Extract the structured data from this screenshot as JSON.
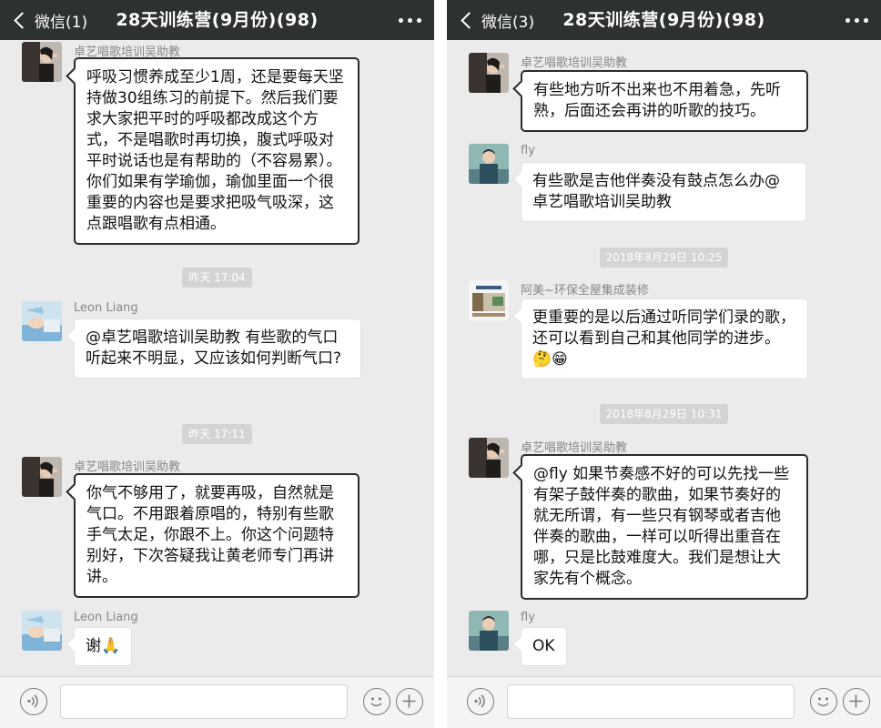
{
  "left": {
    "back_label": "微信(1)",
    "title": "28天训练营(9月份)(98)",
    "messages": [
      {
        "sender": "卓艺唱歌培训吴助教",
        "text": "呼吸习惯养成至少1周，还是要每天坚持做30组练习的前提下。然后我们要求大家把平时的呼吸都改成这个方式，不是唱歌时再切换，腹式呼吸对平时说话也是有帮助的（不容易累）。你们如果有学瑜伽，瑜伽里面一个很重要的内容也是要求把吸气吸深，这点跟唱歌有点相通。"
      },
      {
        "sender": "Leon Liang",
        "text": "@卓艺唱歌培训吴助教 有些歌的气口听起来不明显，又应该如何判断气口?"
      },
      {
        "sender": "卓艺唱歌培训吴助教",
        "text": "你气不够用了，就要再吸，自然就是气口。不用跟着原唱的，特别有些歌手气太足，你跟不上。你这个问题特别好，下次答疑我让黄老师专门再讲讲。"
      },
      {
        "sender": "Leon Liang",
        "text": "谢🙏"
      }
    ],
    "timestamps": [
      "昨天 17:04",
      "昨天 17:11"
    ]
  },
  "right": {
    "back_label": "微信(3)",
    "title": "28天训练营(9月份)(98)",
    "messages": [
      {
        "sender": "卓艺唱歌培训吴助教",
        "text": "有些地方听不出来也不用着急，先听熟，后面还会再讲的听歌的技巧。"
      },
      {
        "sender": "fly",
        "text": "有些歌是吉他伴奏没有鼓点怎么办@卓艺唱歌培训吴助教"
      },
      {
        "sender": "阿美~环保全屋集成装修",
        "text": "更重要的是以后通过听同学们录的歌，还可以看到自己和其他同学的进步。🤔😁"
      },
      {
        "sender": "卓艺唱歌培训吴助教",
        "text": "@fly 如果节奏感不好的可以先找一些有架子鼓伴奏的歌曲，如果节奏好的就无所谓，有一些只有钢琴或者吉他伴奏的歌曲，一样可以听得出重音在哪，只是比鼓难度大。我们是想让大家先有个概念。"
      },
      {
        "sender": "fly",
        "text": "OK"
      }
    ],
    "timestamps": [
      "2018年8月29日 10:25",
      "2018年8月29日 10:31"
    ]
  },
  "icons": {
    "back": "chevron-left-icon",
    "more": "more-dots-icon",
    "voice": "voice-icon",
    "emoji": "emoji-icon",
    "plus": "plus-icon"
  },
  "colors": {
    "navbar": "#2e3132",
    "chat_bg": "#ebebeb",
    "bubble": "#ffffff",
    "timestamp_bg": "#d4d4d4"
  }
}
